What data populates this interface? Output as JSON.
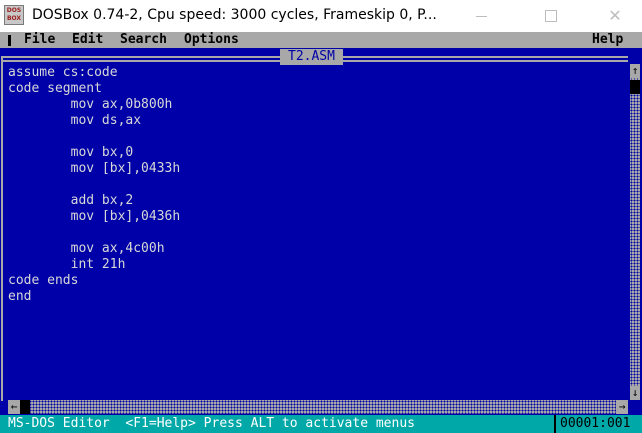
{
  "window": {
    "title": "DOSBox 0.74-2, Cpu speed:     3000 cycles, Frameskip  0, P...",
    "icon_name": "dosbox-icon",
    "icon_text_top": "DOS",
    "icon_text_bottom": "BOX"
  },
  "menu": {
    "items": [
      "File",
      "Edit",
      "Search",
      "Options"
    ],
    "help": "Help"
  },
  "editor": {
    "filename": "T2.ASM",
    "lines": [
      "assume cs:code",
      "code segment",
      "        mov ax,0b800h",
      "        mov ds,ax",
      "",
      "        mov bx,0",
      "        mov [bx],0433h",
      "",
      "        add bx,2",
      "        mov [bx],0436h",
      "",
      "        mov ax,4c00h",
      "        int 21h",
      "code ends",
      "end"
    ]
  },
  "scrollbars": {
    "up": "↑",
    "down": "↓",
    "left": "←",
    "right": "→"
  },
  "status": {
    "text": "MS-DOS Editor  <F1=Help> Press ALT to activate menus",
    "position": "00001:001"
  },
  "colors": {
    "dos_blue": "#0000a8",
    "menu_gray": "#a8a8a8",
    "status_cyan": "#00a8a8",
    "text_light": "#d8d8d8"
  }
}
